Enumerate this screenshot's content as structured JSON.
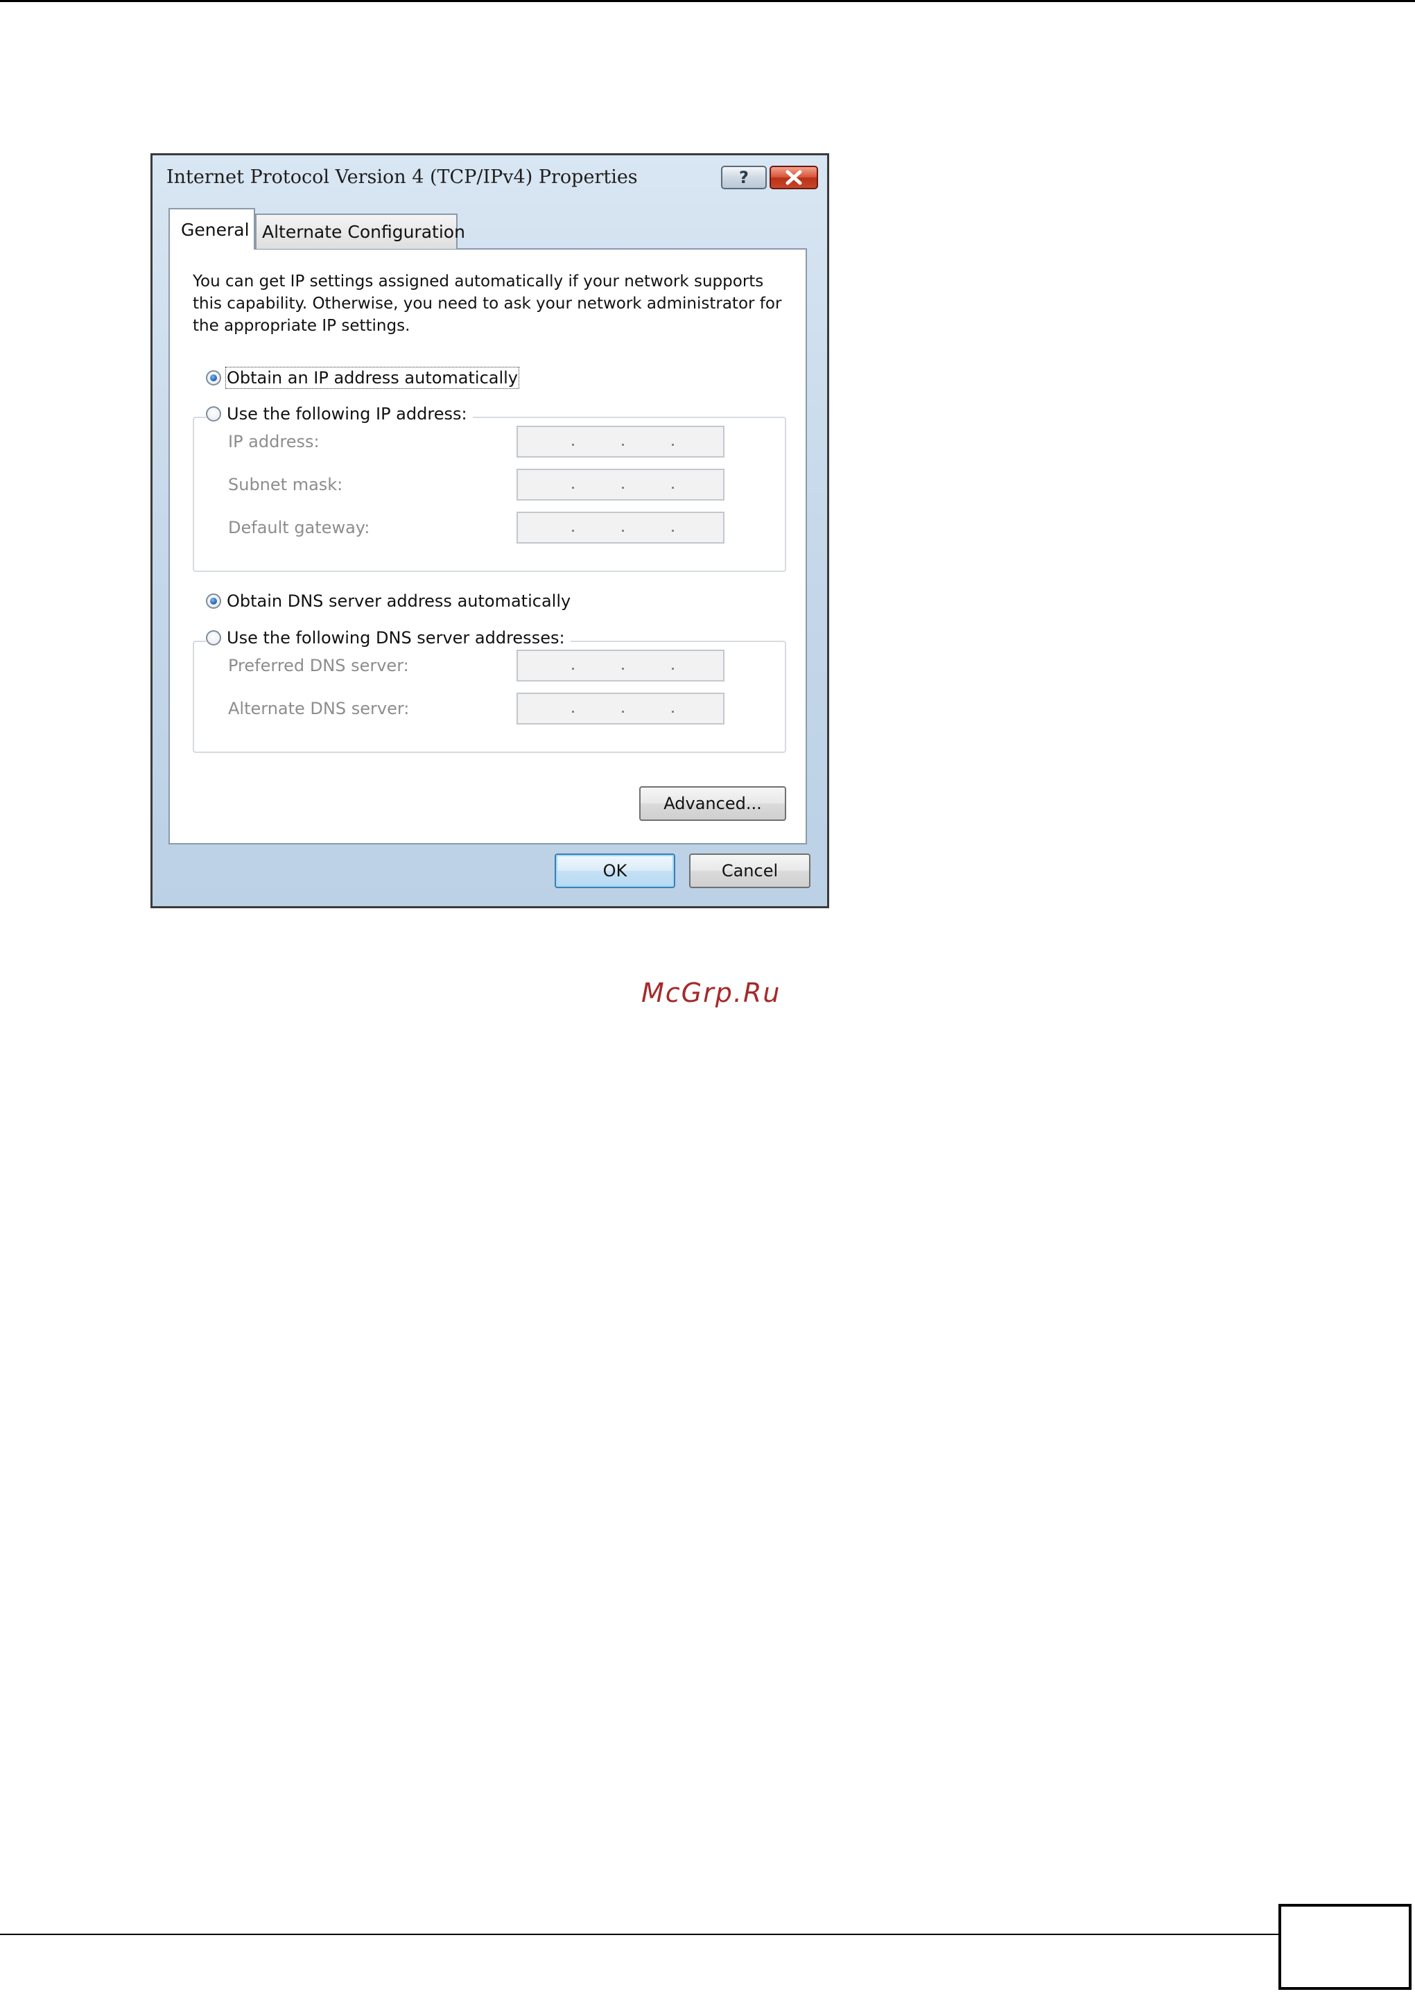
{
  "dialog": {
    "title": "Internet Protocol Version 4 (TCP/IPv4) Properties",
    "help_button": "?",
    "close_button_icon": "close-icon"
  },
  "tabs": [
    {
      "label": "General",
      "selected": true
    },
    {
      "label": "Alternate Configuration",
      "selected": false
    }
  ],
  "description": "You can get IP settings assigned automatically if your network supports this capability. Otherwise, you need to ask your network administrator for the appropriate IP settings.",
  "ip_settings": {
    "auto_option": {
      "label": "Obtain an IP address automatically",
      "selected": true
    },
    "manual_option": {
      "label": "Use the following IP address:",
      "selected": false
    },
    "fields": [
      {
        "label": "IP address:",
        "value": ". . ."
      },
      {
        "label": "Subnet mask:",
        "value": ". . ."
      },
      {
        "label": "Default gateway:",
        "value": ". . ."
      }
    ]
  },
  "dns_settings": {
    "auto_option": {
      "label": "Obtain DNS server address automatically",
      "selected": true
    },
    "manual_option": {
      "label": "Use the following DNS server addresses:",
      "selected": false
    },
    "fields": [
      {
        "label": "Preferred DNS server:",
        "value": ". . ."
      },
      {
        "label": "Alternate DNS server:",
        "value": ". . ."
      }
    ]
  },
  "buttons": {
    "advanced": "Advanced...",
    "ok": "OK",
    "cancel": "Cancel"
  },
  "watermark": "McGrp.Ru"
}
